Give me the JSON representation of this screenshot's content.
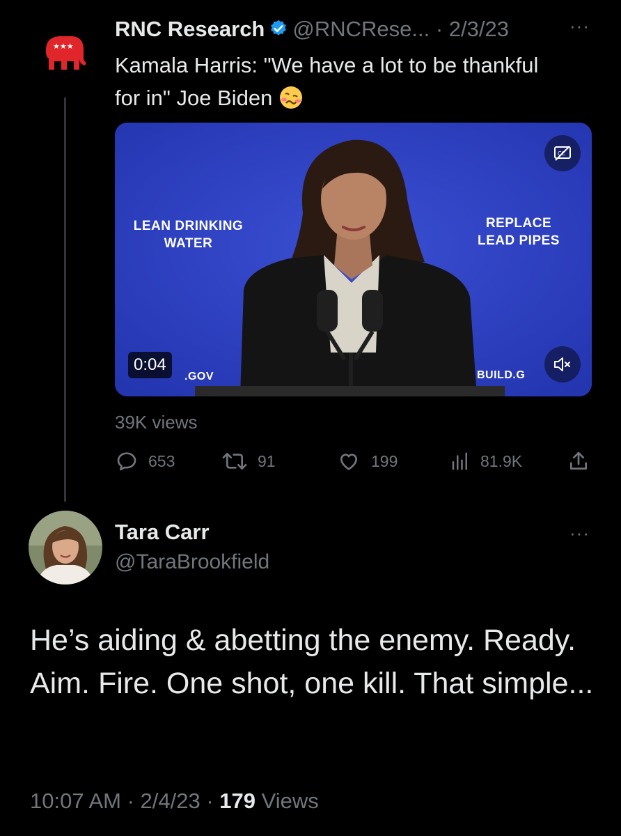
{
  "original_tweet": {
    "author_name": "RNC Research",
    "handle_and_date": "@RNCRese... · 2/3/23",
    "more": "···",
    "text": "Kamala Harris: \"We have a lot to be thankful for in\" Joe Biden",
    "media": {
      "duration": "0:04",
      "sign_left": "LEAN DRINKING\nWATER",
      "sign_right": "REPLACE\nLEAD PIPES",
      "sign_bottom_left": ".GOV",
      "sign_bottom_right": "BUILD.G"
    },
    "views": "39K views",
    "actions": {
      "replies": "653",
      "retweets": "91",
      "likes": "199",
      "analytics": "81.9K"
    }
  },
  "reply_tweet": {
    "author_name": "Tara Carr",
    "handle": "@TaraBrookfield",
    "more": "···",
    "text": "He’s aiding & abetting the enemy. Ready. Aim. Fire. One shot, one kill. That simple...",
    "time_date": "10:07 AM · 2/4/23 · ",
    "view_count": "179",
    "views_label": " Views"
  },
  "colors": {
    "background": "#000000",
    "text_primary": "#e7e9ea",
    "text_secondary": "#71767b",
    "verified_blue": "#1d9bf0",
    "rnc_red": "#e0262b",
    "media_blue": "#2d3fc0"
  },
  "icons": [
    "rnc-elephant-logo",
    "verified-badge-icon",
    "woozy-face-emoji",
    "closed-captions-icon",
    "mute-icon",
    "reply-icon",
    "retweet-icon",
    "like-icon",
    "analytics-icon",
    "share-icon"
  ]
}
